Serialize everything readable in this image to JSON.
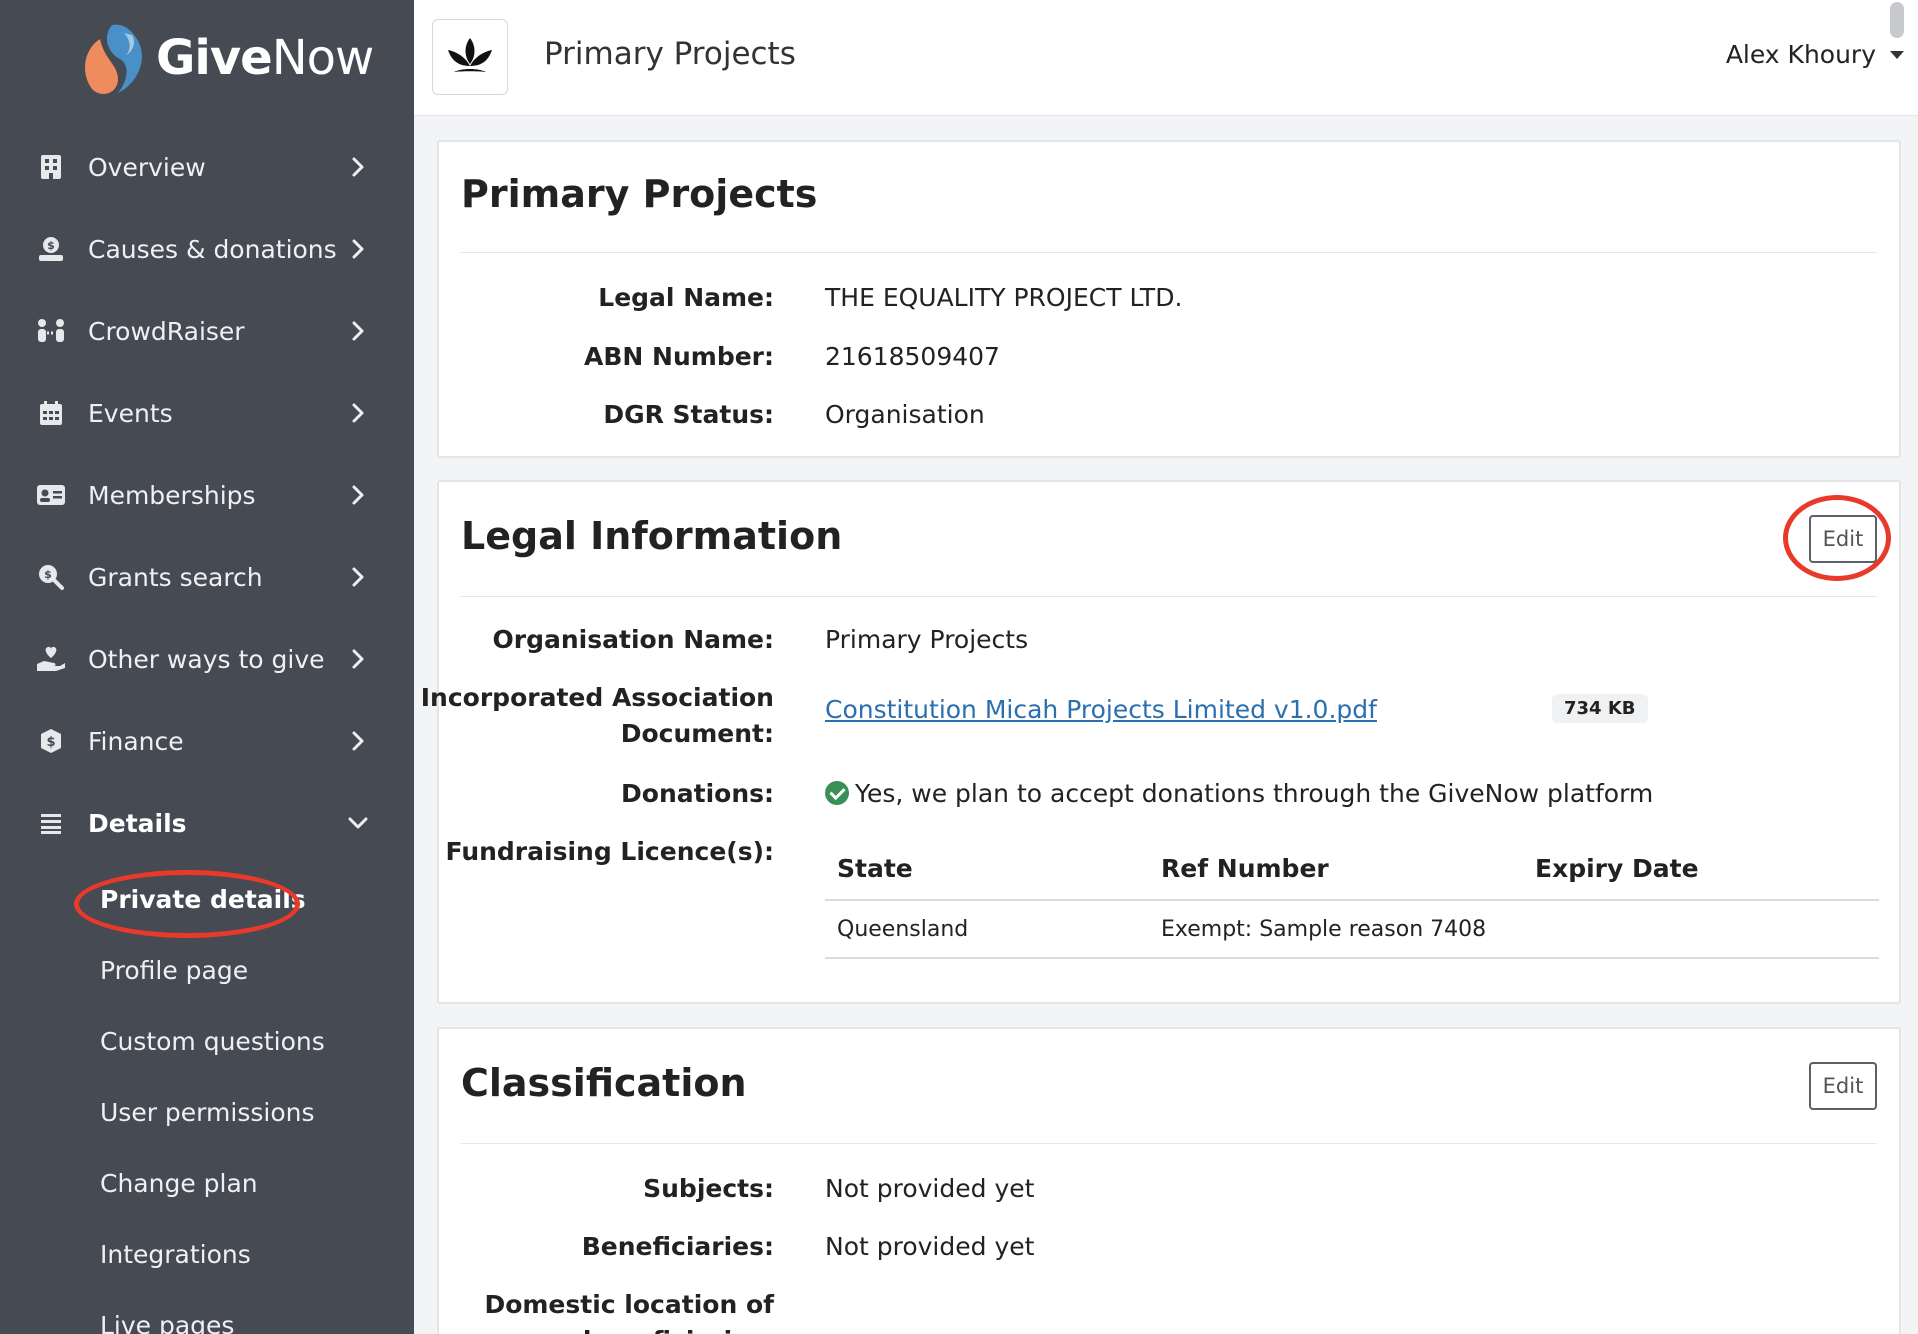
{
  "app": {
    "brand_give": "Give",
    "brand_now": "Now"
  },
  "sidebar": {
    "items": [
      {
        "label": "Overview",
        "icon": "building-icon"
      },
      {
        "label": "Causes & donations",
        "icon": "donation-icon"
      },
      {
        "label": "CrowdRaiser",
        "icon": "crowd-icon"
      },
      {
        "label": "Events",
        "icon": "calendar-icon"
      },
      {
        "label": "Memberships",
        "icon": "id-card-icon"
      },
      {
        "label": "Grants search",
        "icon": "search-dollar-icon"
      },
      {
        "label": "Other ways to give",
        "icon": "hand-heart-icon"
      },
      {
        "label": "Finance",
        "icon": "coin-icon"
      },
      {
        "label": "Details",
        "icon": "list-icon"
      }
    ],
    "sub_items": [
      {
        "label": "Private details"
      },
      {
        "label": "Profile page"
      },
      {
        "label": "Custom questions"
      },
      {
        "label": "User permissions"
      },
      {
        "label": "Change plan"
      },
      {
        "label": "Integrations"
      },
      {
        "label": "Live pages"
      }
    ]
  },
  "header": {
    "org_name": "Primary Projects",
    "user_name": "Alex Khoury"
  },
  "card_primary": {
    "title": "Primary Projects",
    "fields": [
      {
        "key": "Legal Name:",
        "value": "THE EQUALITY PROJECT LTD."
      },
      {
        "key": "ABN Number:",
        "value": "21618509407"
      },
      {
        "key": "DGR Status:",
        "value": "Organisation"
      }
    ]
  },
  "card_legal": {
    "title": "Legal Information",
    "edit_label": "Edit",
    "org_name_key": "Organisation Name:",
    "org_name_value": "Primary Projects",
    "doc_key_line1": "Incorporated Association",
    "doc_key_line2": "Document:",
    "doc_link": "Constitution Micah Projects Limited v1.0.pdf",
    "doc_size": "734 KB",
    "donations_key": "Donations:",
    "donations_value": "Yes, we plan to accept donations through the GiveNow platform",
    "licences_key": "Fundraising Licence(s):",
    "table_headers": [
      "State",
      "Ref Number",
      "Expiry Date"
    ],
    "table_rows": [
      [
        "Queensland",
        "Exempt: Sample reason 7408",
        ""
      ]
    ]
  },
  "card_classification": {
    "title": "Classification",
    "edit_label": "Edit",
    "fields": [
      {
        "key": "Subjects:",
        "value": "Not provided yet"
      },
      {
        "key": "Beneficiaries:",
        "value": "Not provided yet"
      }
    ],
    "partial_key_line1": "Domestic location of",
    "partial_key_line2": "beneficiaries:"
  },
  "colors": {
    "sidebar": "#454a53",
    "accent_red": "#e8392a",
    "link": "#2a6fb0",
    "success": "#3a8f57"
  }
}
